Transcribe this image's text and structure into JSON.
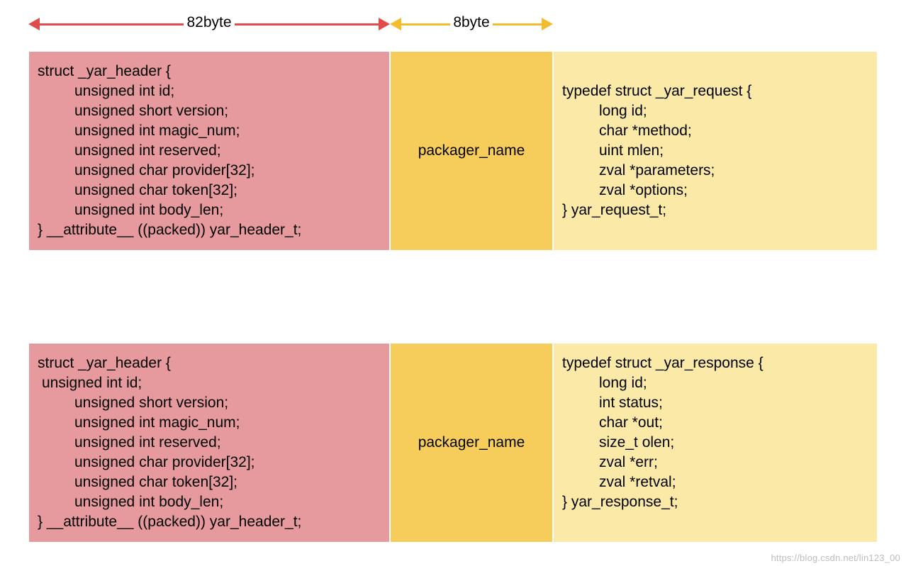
{
  "dimensions": {
    "header_bytes_label": "82byte",
    "packager_bytes_label": "8byte"
  },
  "header_struct": {
    "open": "struct _yar_header {",
    "lines": [
      "unsigned int   id;",
      "unsigned short version;",
      "unsigned int   magic_num;",
      "unsigned int   reserved;",
      "unsigned char  provider[32];",
      "unsigned char  token[32];",
      "unsigned int   body_len;"
    ],
    "close": "} __attribute__ ((packed)) yar_header_t;"
  },
  "header_struct2": {
    "open": "struct _yar_header {",
    "first_line": "unsigned int   id;",
    "lines": [
      "unsigned short version;",
      "unsigned int   magic_num;",
      "unsigned int   reserved;",
      "unsigned char  provider[32];",
      "unsigned char  token[32];",
      "unsigned int   body_len;"
    ],
    "close": "} __attribute__ ((packed)) yar_header_t;"
  },
  "packager_label": "packager_name",
  "request_struct": {
    "open": "typedef struct _yar_request {",
    "lines": [
      "long id;",
      "char *method;",
      "uint mlen;",
      "zval *parameters;",
      "zval *options;"
    ],
    "close": "} yar_request_t;"
  },
  "response_struct": {
    "open": "typedef struct _yar_response {",
    "lines": [
      "long id;",
      "int  status;",
      "char *out;",
      "size_t olen;",
      "zval *err;",
      "zval *retval;"
    ],
    "close": "} yar_response_t;"
  },
  "watermark": "https://blog.csdn.net/lin123_00"
}
